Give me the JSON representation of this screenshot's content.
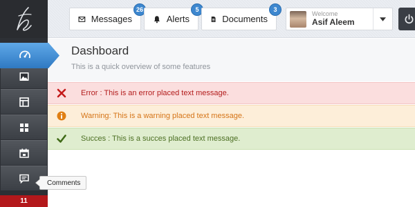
{
  "topbar": {
    "tabs": [
      {
        "label": "Messages",
        "badge": "26",
        "icon": "envelope-icon"
      },
      {
        "label": "Alerts",
        "badge": "5",
        "icon": "bell-icon"
      },
      {
        "label": "Documents",
        "badge": "3",
        "icon": "document-icon"
      }
    ],
    "user": {
      "welcome": "Welcome",
      "name": "Asif Aleem"
    }
  },
  "sidebar": {
    "items": [
      {
        "icon": "dashboard-icon",
        "active": true
      },
      {
        "icon": "image-icon"
      },
      {
        "icon": "layout-icon"
      },
      {
        "icon": "grid-icon"
      },
      {
        "icon": "calendar-icon"
      },
      {
        "icon": "comment-icon"
      }
    ],
    "tooltip": "Comments",
    "count": "11"
  },
  "page": {
    "title": "Dashboard",
    "subtitle": "This is a quick overview of some features"
  },
  "messages": {
    "error": "Error : This is an error placed text message.",
    "warning": "Warning: This is a warning placed text message.",
    "success": "Succes : This is a succes placed text message."
  },
  "colors": {
    "accent": "#3d87cf",
    "error": "#b31c1c",
    "warning": "#d57417",
    "success": "#4c6f23",
    "badge_red": "#b3181b"
  }
}
